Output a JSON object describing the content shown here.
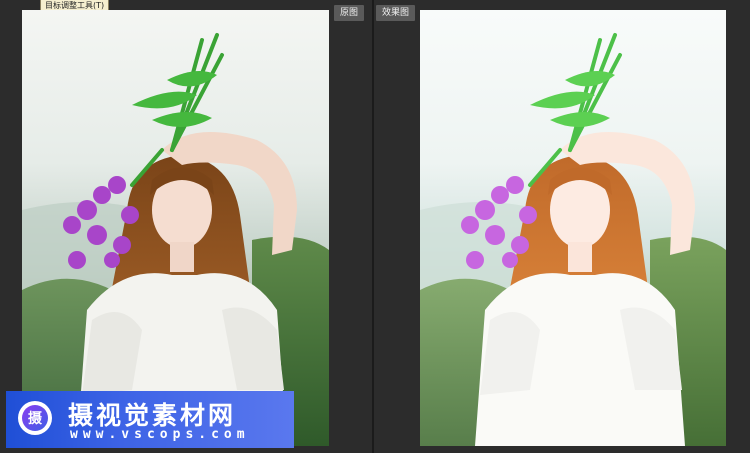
{
  "tooltip": {
    "text": "目标调整工具(T)"
  },
  "panels": {
    "original_label": "原图",
    "result_label": "效果图"
  },
  "watermark": {
    "logo_char": "摄",
    "title": "摄视觉素材网",
    "url": "www.vscops.com"
  },
  "colors": {
    "background": "#2c2c2c",
    "label_bg": "#5a5a5a",
    "watermark_blue": "#3d63e6"
  }
}
